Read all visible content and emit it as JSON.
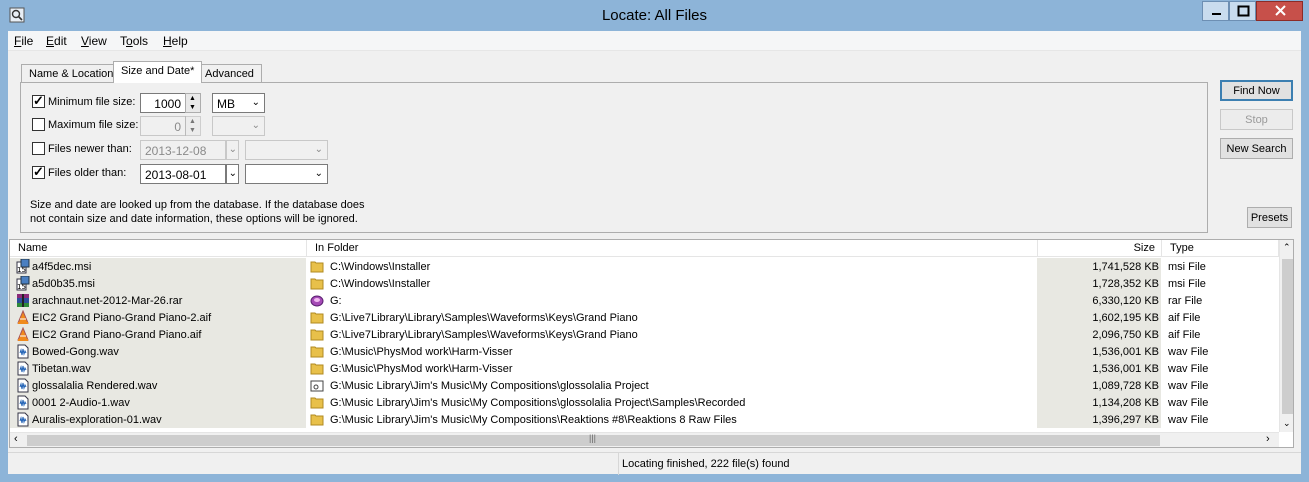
{
  "window": {
    "title": "Locate: All Files"
  },
  "menu": [
    {
      "pre": "",
      "key": "F",
      "post": "ile"
    },
    {
      "pre": "",
      "key": "E",
      "post": "dit"
    },
    {
      "pre": "",
      "key": "V",
      "post": "iew"
    },
    {
      "pre": "T",
      "key": "o",
      "post": "ols"
    },
    {
      "pre": "",
      "key": "H",
      "post": "elp"
    }
  ],
  "tabs": {
    "name_location": "Name & Location",
    "size_date": "Size and Date*",
    "advanced": "Advanced"
  },
  "size_date": {
    "min": {
      "label": "Minimum file size:",
      "checked": true,
      "value": "1000",
      "unit": "MB"
    },
    "max": {
      "label": "Maximum file size:",
      "checked": false,
      "value": "0",
      "unit": ""
    },
    "newer": {
      "label": "Files newer than:",
      "checked": false,
      "date": "2013-12-08",
      "mode": ""
    },
    "older": {
      "label": "Files older than:",
      "checked": true,
      "date": "2013-08-01",
      "mode": ""
    },
    "note_line1": "Size and date are looked up from the database. If the database does",
    "note_line2": "not contain size and date information, these options will be ignored."
  },
  "buttons": {
    "find_now": "Find Now",
    "stop": "Stop",
    "new_search": "New Search",
    "presets": "Presets"
  },
  "columns": {
    "name": "Name",
    "folder": "In Folder",
    "size": "Size",
    "type": "Type"
  },
  "rows": [
    {
      "name": "a4f5dec.msi",
      "folder": "C:\\Windows\\Installer",
      "size": "1,741,528 KB",
      "type": "msi File",
      "icon": "msi-icon",
      "folder_icon": "folder-icon"
    },
    {
      "name": "a5d0b35.msi",
      "folder": "C:\\Windows\\Installer",
      "size": "1,728,352 KB",
      "type": "msi File",
      "icon": "msi-icon",
      "folder_icon": "folder-icon"
    },
    {
      "name": "arachnaut.net-2012-Mar-26.rar",
      "folder": "G:",
      "size": "6,330,120 KB",
      "type": "rar File",
      "icon": "rar-icon",
      "folder_icon": "drive-icon"
    },
    {
      "name": "EIC2 Grand Piano-Grand Piano-2.aif",
      "folder": "G:\\Live7Library\\Library\\Samples\\Waveforms\\Keys\\Grand Piano",
      "size": "1,602,195 KB",
      "type": "aif File",
      "icon": "vlc-icon",
      "folder_icon": "folder-icon"
    },
    {
      "name": "EIC2 Grand Piano-Grand Piano.aif",
      "folder": "G:\\Live7Library\\Library\\Samples\\Waveforms\\Keys\\Grand Piano",
      "size": "2,096,750 KB",
      "type": "aif File",
      "icon": "vlc-icon",
      "folder_icon": "folder-icon"
    },
    {
      "name": "Bowed-Gong.wav",
      "folder": "G:\\Music\\PhysMod work\\Harm-Visser",
      "size": "1,536,001 KB",
      "type": "wav File",
      "icon": "wav-icon",
      "folder_icon": "folder-icon"
    },
    {
      "name": "Tibetan.wav",
      "folder": "G:\\Music\\PhysMod work\\Harm-Visser",
      "size": "1,536,001 KB",
      "type": "wav File",
      "icon": "wav-icon",
      "folder_icon": "folder-icon"
    },
    {
      "name": "glossalalia Rendered.wav",
      "folder": "G:\\Music Library\\Jim's Music\\My Compositions\\glossolalia Project",
      "size": "1,089,728 KB",
      "type": "wav File",
      "icon": "wav-icon",
      "folder_icon": "project-folder-icon"
    },
    {
      "name": "0001 2-Audio-1.wav",
      "folder": "G:\\Music Library\\Jim's Music\\My Compositions\\glossolalia Project\\Samples\\Recorded",
      "size": "1,134,208 KB",
      "type": "wav File",
      "icon": "wav-icon",
      "folder_icon": "folder-icon"
    },
    {
      "name": "Auralis-exploration-01.wav",
      "folder": "G:\\Music Library\\Jim's Music\\My Compositions\\Reaktions #8\\Reaktions 8 Raw Files",
      "size": "1,396,297 KB",
      "type": "wav File",
      "icon": "wav-icon",
      "folder_icon": "folder-icon"
    }
  ],
  "status": {
    "text": "Locating finished, 222 file(s) found"
  }
}
